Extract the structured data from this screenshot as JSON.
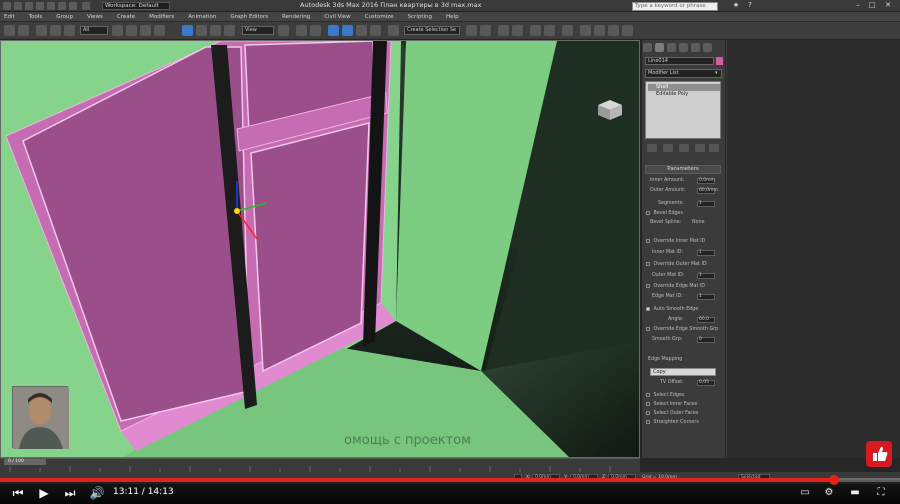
{
  "app": {
    "title": "Autodesk 3ds Max 2016     План квартиры в 3d max.max",
    "workspace": "Workspace: Default",
    "search_placeholder": "Type a keyword or phrase"
  },
  "menu": [
    "Edit",
    "Tools",
    "Group",
    "Views",
    "Create",
    "Modifiers",
    "Animation",
    "Graph Editors",
    "Rendering",
    "Civil View",
    "Customize",
    "Scripting",
    "Help"
  ],
  "toolbar": {
    "selection_filter": "All",
    "view_select": "View",
    "selection_set": "Create Selection Se"
  },
  "command_panel": {
    "object_name": "Line014",
    "object_color": "#d65aa8",
    "modifier_list": "Modifier List",
    "stack": [
      {
        "label": "Shell",
        "selected": true
      },
      {
        "label": "Editable Poly",
        "selected": false
      }
    ],
    "rollout_title": "Parameters",
    "params": {
      "inner_amount_label": "Inner Amount:",
      "inner_amount": "0,0mm",
      "outer_amount_label": "Outer Amount:",
      "outer_amount": "60,0mm",
      "segments_label": "Segments:",
      "segments": "1",
      "bevel_edges_label": "Bevel Edges",
      "bevel_spline_label": "Bevel Spline:",
      "bevel_spline_value": "None",
      "override_inner_mat_label": "Override Inner Mat ID",
      "inner_mat_label": "Inner Mat ID:",
      "inner_mat_value": "1",
      "override_outer_mat_label": "Override Outer Mat ID",
      "outer_mat_label": "Outer Mat ID:",
      "outer_mat_value": "1",
      "override_edge_mat_label": "Override Edge Mat ID",
      "edge_mat_label": "Edge Mat ID:",
      "edge_mat_value": "1",
      "auto_smooth_label": "Auto Smooth Edge",
      "angle_label": "Angle:",
      "angle_value": "60,0",
      "override_edge_smooth_label": "Override Edge Smooth Grp",
      "smooth_group_label": "Smooth Grp:",
      "smooth_group_value": "0",
      "edge_mapping_label": "Edge Mapping",
      "edge_mapping_value": "Copy",
      "tv_offset_label": "TV Offset:",
      "tv_offset_value": "0,05",
      "select_edges_label": "Select Edges",
      "select_inner_label": "Select Inner Faces",
      "select_outer_label": "Select Outer Faces",
      "straighten_label": "Straighten Corners"
    }
  },
  "timeline": {
    "frame_display": "0 / 100"
  },
  "statusbar": {
    "x_label": "X:",
    "x_value": "0,0mm",
    "y_label": "Y:",
    "y_value": "0,0mm",
    "z_label": "Z:",
    "z_value": "0,0mm",
    "grid_label": "Grid = 10,0mm",
    "key_mode": "Selected"
  },
  "overlay": {
    "watermark": "омощь с проектом"
  },
  "player": {
    "current_time": "13:11",
    "duration": "14:13",
    "progress": 0.927,
    "accent": "#e62117"
  }
}
